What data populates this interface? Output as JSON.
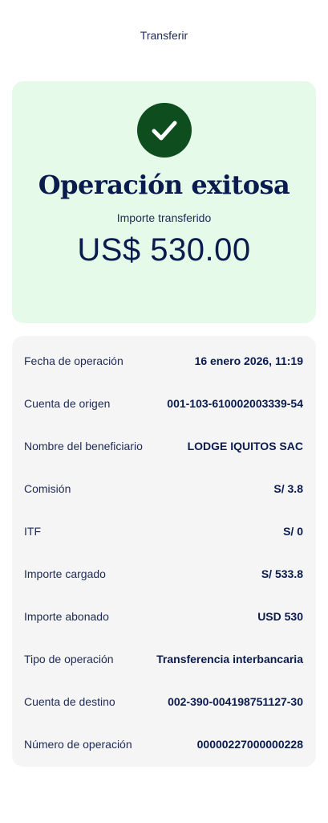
{
  "header": {
    "title": "Transferir"
  },
  "success": {
    "icon": "check-icon",
    "title": "Operación exitosa",
    "amount_label": "Importe transferido",
    "amount_value": "US$ 530.00",
    "card_color": "#e6faea",
    "icon_color": "#0e4e1e"
  },
  "details": {
    "rows": [
      {
        "label": "Fecha de operación",
        "value": "16 enero 2026, 11:19"
      },
      {
        "label": "Cuenta de origen",
        "value": "001-103-610002003339-54"
      },
      {
        "label": "Nombre del beneficiario",
        "value": "LODGE IQUITOS SAC"
      },
      {
        "label": "Comisión",
        "value": "S/ 3.8"
      },
      {
        "label": "ITF",
        "value": "S/ 0"
      },
      {
        "label": "Importe cargado",
        "value": "S/ 533.8"
      },
      {
        "label": "Importe abonado",
        "value": "USD 530"
      },
      {
        "label": "Tipo de operación",
        "value": "Transferencia interbancaria"
      },
      {
        "label": "Cuenta de destino",
        "value": "002-390-004198751127-30"
      },
      {
        "label": "Número de operación",
        "value": "00000227000000228"
      }
    ]
  }
}
